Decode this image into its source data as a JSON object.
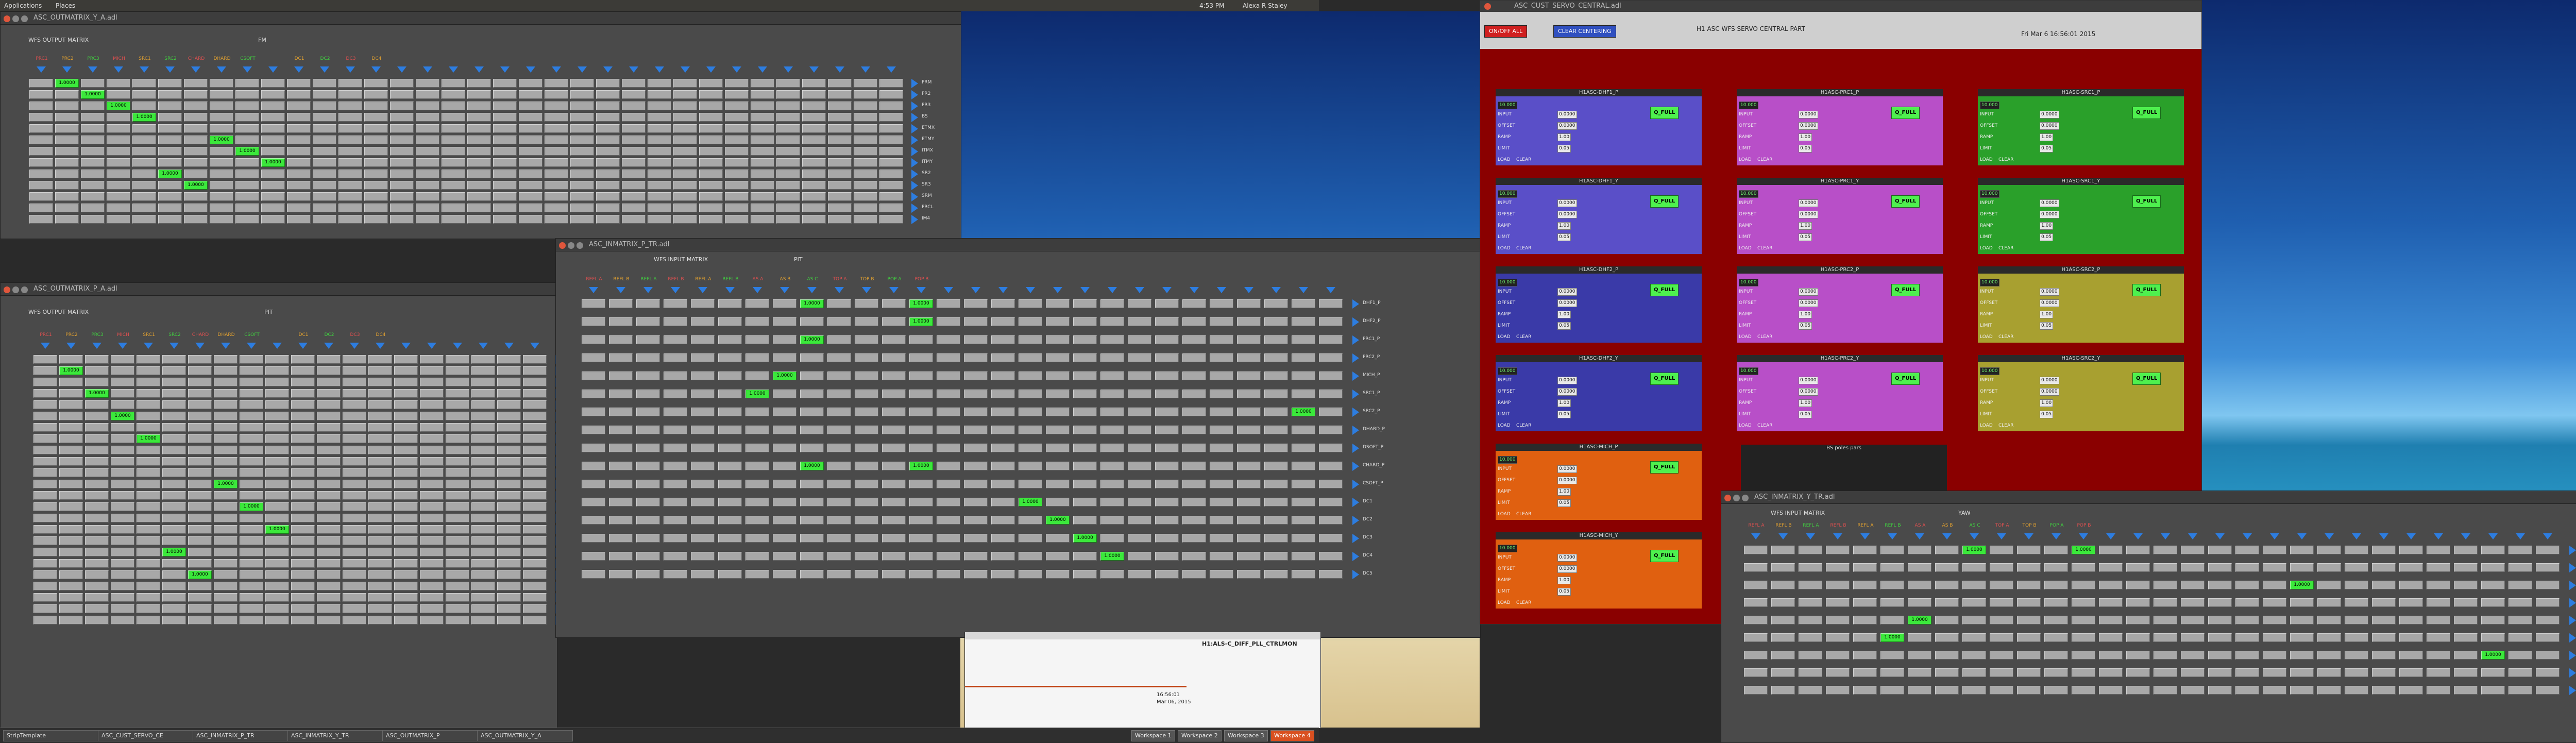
{
  "topbar": {
    "applications": "Applications",
    "places": "Places",
    "time": "4:53 PM",
    "user": "Alexa R Staley"
  },
  "taskbar": {
    "tasks": [
      "StripTemplate",
      "ASC_CUST_SERVO_CE",
      "ASC_INMATRIX_P_TR",
      "ASC_INMATRIX_Y_TR",
      "ASC_OUTMATRIX_P",
      "ASC_OUTMATRIX_Y_A"
    ],
    "workspaces": [
      "Workspace 1",
      "Workspace 2",
      "Workspace 3",
      "Workspace 4"
    ]
  },
  "windows": {
    "outmatrix_y": {
      "title": "ASC_OUTMATRIX_Y_A.adl",
      "heading": "WFS OUTPUT MATRIX",
      "sub": "FM"
    },
    "outmatrix_p": {
      "title": "ASC_OUTMATRIX_P_A.adl",
      "heading": "WFS OUTPUT MATRIX",
      "sub": "PIT"
    },
    "inmatrix_p": {
      "title": "ASC_INMATRIX_P_TR.adl",
      "heading": "WFS INPUT MATRIX",
      "sub": "PIT"
    },
    "inmatrix_y": {
      "title": "ASC_INMATRIX_Y_TR.adl",
      "heading": "WFS INPUT MATRIX",
      "sub": "YAW"
    },
    "servo": {
      "title": "ASC_CUST_SERVO_CENTRAL.adl"
    }
  },
  "outmatrix_cols": [
    "PRC1",
    "PRC2",
    "PRC3",
    "MICH",
    "SRC1",
    "SRC2",
    "CHARD",
    "DHARD",
    "CSOFT",
    "",
    "DC1",
    "DC2",
    "DC3",
    "DC4"
  ],
  "outmatrix_rows": [
    "PRM",
    "PR2",
    "PR3",
    "BS",
    "ETMX",
    "ETMY",
    "ITMX",
    "ITMY",
    "SR2",
    "SR3",
    "SRM",
    "PRCL",
    "IM4"
  ],
  "outmatrix_on": [
    [
      0,
      1,
      "1.0000"
    ],
    [
      1,
      2,
      "1.0000"
    ],
    [
      2,
      3,
      "1.0000"
    ],
    [
      3,
      4,
      "1.0000"
    ],
    [
      5,
      7,
      "1.0000"
    ],
    [
      6,
      8,
      "1.0000"
    ],
    [
      7,
      9,
      "1.0000"
    ],
    [
      8,
      5,
      "1.0000"
    ],
    [
      9,
      6,
      "1.0000"
    ]
  ],
  "inmatrix_cols": [
    "REFL A",
    "REFL B",
    "REFL A",
    "REFL B",
    "REFL A",
    "REFL B",
    "AS A",
    "AS B",
    "AS C",
    "TOP A",
    "TOP B",
    "POP A",
    "POP B"
  ],
  "inmatrix_rows": [
    "DHF1_P",
    "DHF2_P",
    "PRC1_P",
    "PRC2_P",
    "MICH_P",
    "SRC1_P",
    "SRC2_P",
    "DHARD_P",
    "DSOFT_P",
    "CHARD_P",
    "CSOFT_P",
    "DC1",
    "DC2",
    "DC3",
    "DC4",
    "DC5"
  ],
  "servo": {
    "title": "H1 ASC WFS SERVO CENTRAL PART",
    "date": "Fri Mar 6 16:56:01 2015",
    "btn_on": "ON/OFF ALL",
    "btn_center": "CLEAR CENTERING",
    "panels": [
      {
        "name": "H1ASC-DHF1_P",
        "color": "#5a4fc8"
      },
      {
        "name": "H1ASC-PRC1_P",
        "color": "#b84fc8"
      },
      {
        "name": "H1ASC-SRC1_P",
        "color": "#2aa02a"
      },
      {
        "name": "H1ASC-DHF1_Y",
        "color": "#5a4fc8"
      },
      {
        "name": "H1ASC-PRC1_Y",
        "color": "#b84fc8"
      },
      {
        "name": "H1ASC-SRC1_Y",
        "color": "#2aa02a"
      },
      {
        "name": "H1ASC-DHF2_P",
        "color": "#3a3aa8"
      },
      {
        "name": "H1ASC-PRC2_P",
        "color": "#b84fc8"
      },
      {
        "name": "H1ASC-SRC2_P",
        "color": "#a8a030"
      },
      {
        "name": "H1ASC-DHF2_Y",
        "color": "#3a3aa8"
      },
      {
        "name": "H1ASC-PRC2_Y",
        "color": "#b84fc8"
      },
      {
        "name": "H1ASC-SRC2_Y",
        "color": "#a8a030"
      },
      {
        "name": "H1ASC-MICH_P",
        "color": "#e06010"
      },
      {
        "name": "H1ASC-MICH_Y",
        "color": "#e06010"
      }
    ],
    "panel_labels": {
      "input": "INPUT",
      "offset": "OFFSET",
      "limit": "LIMIT",
      "ramp": "RAMP",
      "gain": "GAIN",
      "full": "FULL",
      "clear": "CLEAR",
      "load": "LOAD",
      "in": "IN",
      "out": "OUT"
    },
    "field_vals": [
      "0.0000",
      "0.0000",
      "1.00",
      "0.05",
      "10.000"
    ],
    "fullbtn": "Q_FULL",
    "bs_title": "BS poles pars"
  },
  "strip": {
    "title": "H1:ALS-C_DIFF_PLL_CTRLMON",
    "time": "16:56:01",
    "date": "Mar 06, 2015"
  },
  "colors": {
    "accent_green": "#3be83b",
    "arrow_blue": "#2d7de0",
    "servo_red": "#8a0000"
  }
}
